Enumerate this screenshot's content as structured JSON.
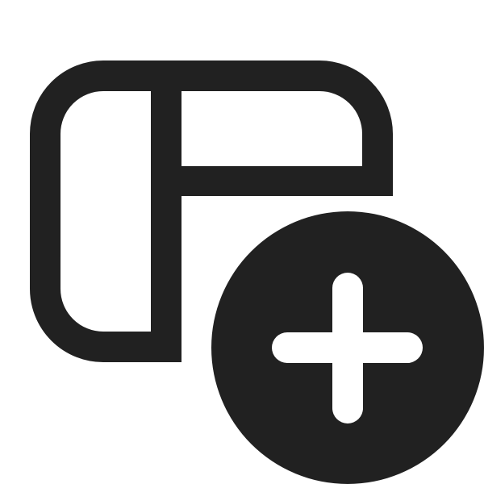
{
  "icon": {
    "name": "table-add-icon",
    "primary_color": "#212121",
    "background_color": "#ffffff",
    "accent_glyph_color": "#ffffff"
  },
  "parts": {
    "frame": "layout-frame-icon",
    "badge": "add-circle-icon",
    "plus": "plus-icon"
  }
}
